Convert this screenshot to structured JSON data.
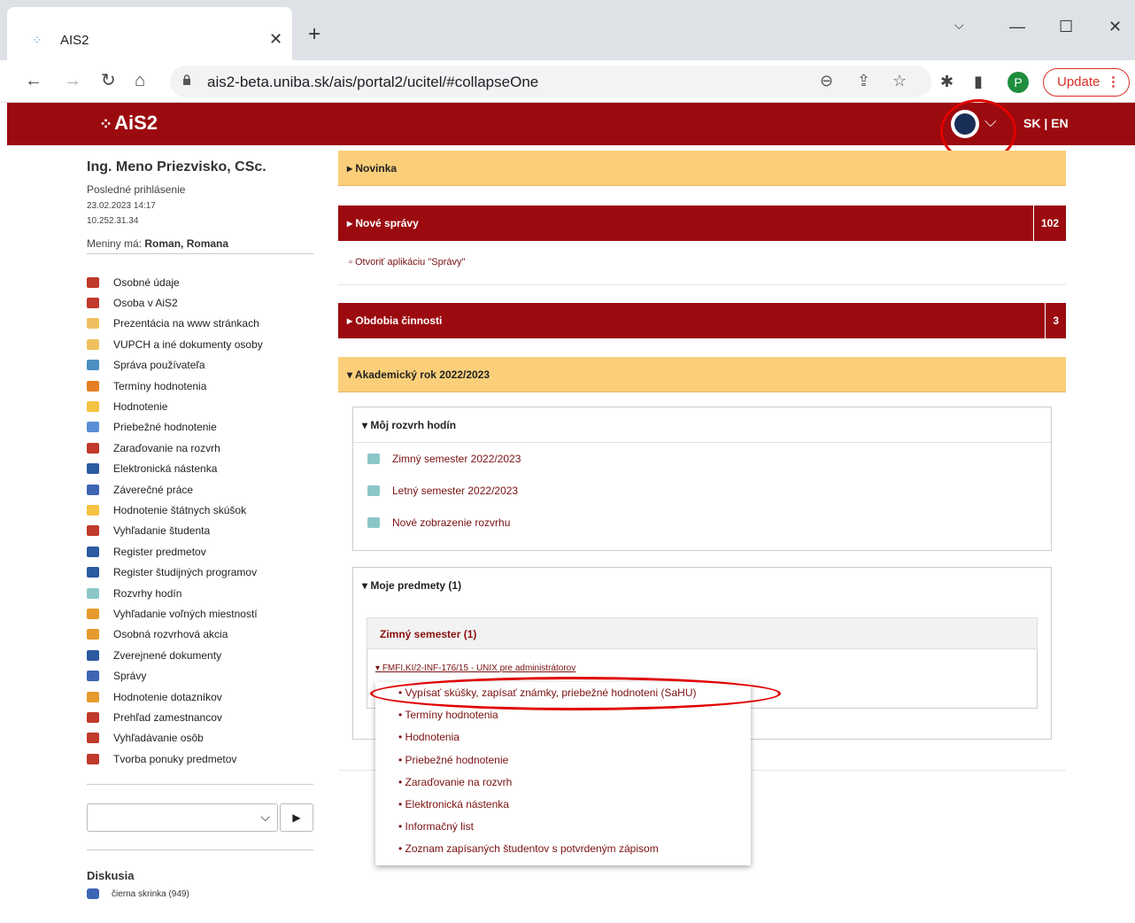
{
  "browser": {
    "tab_title": "AIS2",
    "url": "ais2-beta.uniba.sk/ais/portal2/ucitel/#collapseOne",
    "profile_initial": "P",
    "update_label": "Update"
  },
  "header": {
    "logo_text": "AiS2",
    "lang": "SK | EN"
  },
  "user": {
    "name": "Ing. Meno Priezvisko, CSc.",
    "last_login_label": "Posledné prihlásenie",
    "last_login_time": "23.02.2023 14:17",
    "last_login_ip": "10.252.31.34",
    "namedays_label": "Meniny má:",
    "namedays_names": "Roman, Romana"
  },
  "sidebar": {
    "items": [
      {
        "label": "Osobné údaje",
        "color": "#c0392b"
      },
      {
        "label": "Osoba v AiS2",
        "color": "#c0392b"
      },
      {
        "label": "Prezentácia na www stránkach",
        "color": "#f0c060"
      },
      {
        "label": "VUPCH a iné dokumenty osoby",
        "color": "#f0c060"
      },
      {
        "label": "Správa používateľa",
        "color": "#4a90c0"
      },
      {
        "label": "Termíny hodnotenia",
        "color": "#e67e22"
      },
      {
        "label": "Hodnotenie",
        "color": "#f5c242"
      },
      {
        "label": "Priebežné hodnotenie",
        "color": "#5b8dd6"
      },
      {
        "label": "Zaraďovanie na rozvrh",
        "color": "#c0392b"
      },
      {
        "label": "Elektronická nástenka",
        "color": "#2c5aa0"
      },
      {
        "label": "Záverečné práce",
        "color": "#3e65b4"
      },
      {
        "label": "Hodnotenie štátnych skúšok",
        "color": "#f5c242"
      },
      {
        "label": "Vyhľadanie študenta",
        "color": "#c0392b"
      },
      {
        "label": "Register predmetov",
        "color": "#2c5aa0"
      },
      {
        "label": "Register študijných programov",
        "color": "#2c5aa0"
      },
      {
        "label": "Rozvrhy hodín",
        "color": "#8cc6c8"
      },
      {
        "label": "Vyhľadanie voľných miestností",
        "color": "#e69a2e"
      },
      {
        "label": "Osobná rozvrhová akcia",
        "color": "#e69a2e"
      },
      {
        "label": "Zverejnené dokumenty",
        "color": "#2c5aa0"
      },
      {
        "label": "Správy",
        "color": "#3e65b4"
      },
      {
        "label": "Hodnotenie dotazníkov",
        "color": "#e69a2e"
      },
      {
        "label": "Prehľad zamestnancov",
        "color": "#c0392b"
      },
      {
        "label": "Vyhľadávanie osôb",
        "color": "#c0392b"
      },
      {
        "label": "Tvorba ponuky predmetov",
        "color": "#c0392b"
      }
    ],
    "discussion_title": "Diskusia",
    "discussion_item": "čierna skrinka (949)"
  },
  "panels": {
    "news": "Novinka",
    "messages": "Nové správy",
    "messages_count": "102",
    "messages_link": "Otvoriť aplikáciu \"Správy\"",
    "periods": "Obdobia činnosti",
    "periods_count": "3",
    "year": "Akademický rok 2022/2023"
  },
  "schedule": {
    "title": "Môj rozvrh hodín",
    "items": [
      "Zimný semester 2022/2023",
      "Letný semester 2022/2023",
      "Nové zobrazenie rozvrhu"
    ]
  },
  "subjects": {
    "title": "Moje predmety (1)",
    "semester": "Zimný semester (1)",
    "subject": "FMFI.KI/2-INF-176/15 - UNIX pre administrátorov",
    "actions": [
      "Vypísať skúšky, zapísať známky, priebežné hodnoteni (SaHU)",
      "Termíny hodnotenia",
      "Hodnotenia",
      "Priebežné hodnotenie",
      "Zaraďovanie na rozvrh",
      "Elektronická nástenka",
      "Informačný list",
      "Zoznam zapísaných študentov s potvrdeným zápisom"
    ]
  }
}
